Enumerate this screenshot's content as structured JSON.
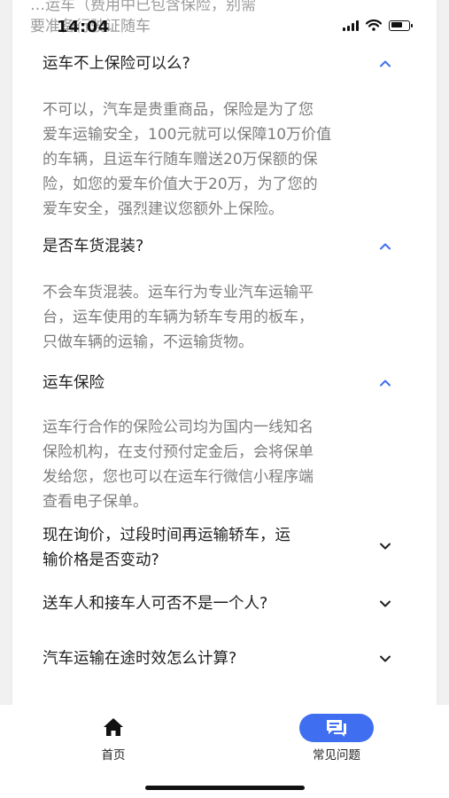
{
  "status_bar": {
    "time": "14:04"
  },
  "cutoff_text": [
    "…运车（费用中已包含保险，别需",
    "要准备行驶证随车"
  ],
  "faqs": [
    {
      "question": "运车不上保险可以么?",
      "expanded": true,
      "answer_lines": [
        "不可以，汽车是贵重商品，保险是为了您",
        "爱车运输安全，100元就可以保障10万价值",
        "的车辆，且运车行随车赠送20万保额的保",
        "险，如您的爱车价值大于20万，为了您的",
        "爱车安全，强烈建议您额外上保险。"
      ]
    },
    {
      "question": "是否车货混装?",
      "expanded": true,
      "answer_lines": [
        "不会车货混装。运车行为专业汽车运输平",
        "台，运车使用的车辆为轿车专用的板车，",
        "只做车辆的运输，不运输货物。"
      ]
    },
    {
      "question": "运车保险",
      "expanded": true,
      "answer_lines": [
        "运车行合作的保险公司均为国内一线知名",
        "保险机构，在支付预付定金后，会将保单",
        "发给您，您也可以在运车行微信小程序端",
        "查看电子保单。"
      ]
    },
    {
      "question_lines": [
        "现在询价，过段时间再运输轿车，运",
        "输价格是否变动?"
      ],
      "expanded": false
    },
    {
      "question": "送车人和接车人可否不是一个人?",
      "expanded": false
    },
    {
      "question": "汽车运输在途时效怎么计算?",
      "expanded": false
    }
  ],
  "tabbar": {
    "home_label": "首页",
    "faq_label": "常见问题",
    "active_color": "#3f6ff0",
    "chevron_color": "#3f6ff0"
  }
}
